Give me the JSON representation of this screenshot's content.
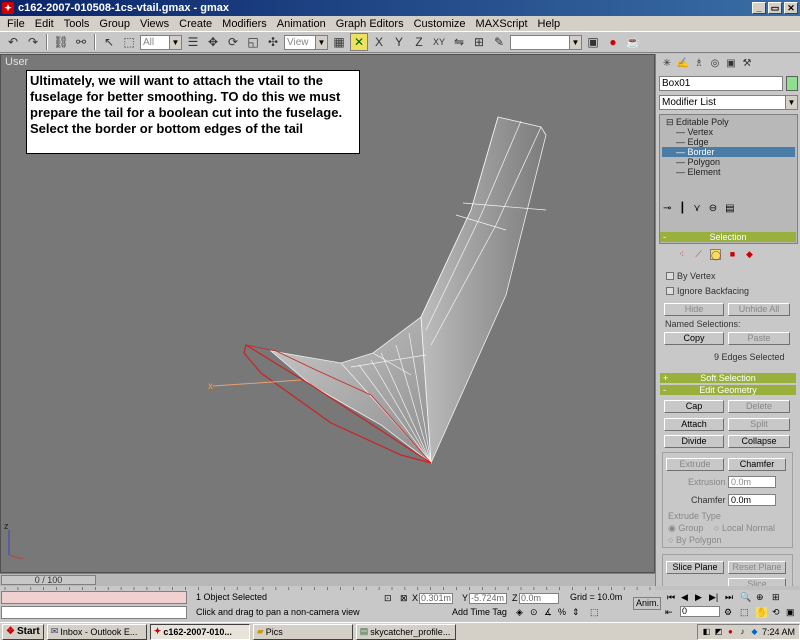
{
  "window": {
    "title": "c162-2007-010508-1cs-vtail.gmax - gmax",
    "buttons": [
      "_",
      "▭",
      "✕"
    ]
  },
  "menu": [
    "File",
    "Edit",
    "Tools",
    "Group",
    "Views",
    "Create",
    "Modifiers",
    "Animation",
    "Graph Editors",
    "Customize",
    "MAXScript",
    "Help"
  ],
  "toolbar": {
    "selection_filter": "All",
    "reference_coord": "View",
    "axis_labels": [
      "X",
      "Y",
      "Z",
      "XY"
    ]
  },
  "viewport": {
    "label": "User",
    "note": "Ultimately, we will want to attach the vtail to the fuselage for better smoothing.  TO do this we must prepare the tail for a boolean cut into the fuselage.  Select the border or bottom edges of the tail",
    "axis_x": "x",
    "axis_z": "z"
  },
  "command_panel": {
    "object_name": "Box01",
    "object_color": "#8ee08e",
    "modifier_list": "Modifier List",
    "stack": [
      {
        "label": "Editable Poly",
        "level": 0
      },
      {
        "label": "Vertex",
        "level": 1
      },
      {
        "label": "Edge",
        "level": 1
      },
      {
        "label": "Border",
        "level": 1
      },
      {
        "label": "Polygon",
        "level": 1
      },
      {
        "label": "Element",
        "level": 1
      }
    ],
    "selected_stack_item": "Border",
    "selection": {
      "title": "Selection",
      "by_vertex": "By Vertex",
      "ignore_backfacing": "Ignore Backfacing",
      "hide": "Hide",
      "unhide_all": "Unhide All",
      "named_selections": "Named Selections:",
      "copy": "Copy",
      "paste": "Paste",
      "status": "9 Edges Selected"
    },
    "soft_selection": "Soft Selection",
    "edit_geometry": {
      "title": "Edit Geometry",
      "cap": "Cap",
      "delete": "Delete",
      "attach": "Attach",
      "split": "Split",
      "divide": "Divide",
      "collapse": "Collapse",
      "extrude": "Extrude",
      "chamfer": "Chamfer",
      "extrusion_label": "Extrusion",
      "extrusion_value": "0.0m",
      "chamfer_label": "Chamfer",
      "chamfer_value": "0.0m",
      "extrude_type": "Extrude Type",
      "group": "Group",
      "local_normal": "Local Normal",
      "by_polygon": "By Polygon",
      "slice_plane": "Slice Plane",
      "reset_plane": "Reset Plane",
      "slice": "Slice"
    }
  },
  "timeline": {
    "frame_label": "0 / 100",
    "ticks": [
      "0",
      "10",
      "20",
      "30",
      "40",
      "50",
      "60",
      "70",
      "80",
      "90",
      "100"
    ]
  },
  "status": {
    "objects_selected": "1 Object Selected",
    "prompt": "Click and drag to pan a non-camera view",
    "x_label": "X",
    "x_value": "0.301m",
    "y_label": "Y",
    "y_value": "-5.724m",
    "z_label": "Z",
    "z_value": "0.0m",
    "grid": "Grid = 10.0m",
    "add_time_tag": "Add Time Tag",
    "anim": "Anim.",
    "frame_value": "0"
  },
  "taskbar": {
    "start": "Start",
    "tasks": [
      "Inbox - Outlook E...",
      "c162-2007-010...",
      "Pics",
      "skycatcher_profile..."
    ],
    "active_task": 1,
    "clock": "7:24 AM"
  }
}
